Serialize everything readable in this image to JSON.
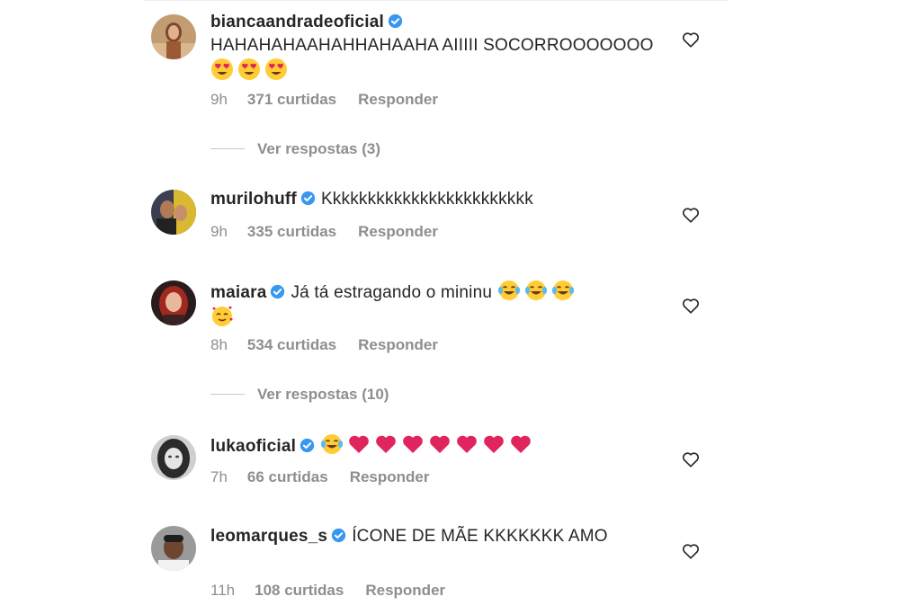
{
  "comments": [
    {
      "username": "biancaandradeoficial",
      "text": "HAHAHAHAAHAHHAHAAHA AIIIII SOCORROOOOOOO",
      "emojis": [
        "heart-eyes",
        "heart-eyes",
        "heart-eyes"
      ],
      "time": "9h",
      "likes": "371 curtidas",
      "reply_label": "Responder",
      "view_replies": "Ver respostas (3)"
    },
    {
      "username": "murilohuff",
      "text": "Kkkkkkkkkkkkkkkkkkkkkkkk",
      "emojis": [],
      "time": "9h",
      "likes": "335 curtidas",
      "reply_label": "Responder"
    },
    {
      "username": "maiara",
      "text": "Já tá estragando o mininu",
      "emojis": [
        "tears-of-joy",
        "tears-of-joy",
        "tears-of-joy",
        "smiling-hearts"
      ],
      "time": "8h",
      "likes": "534 curtidas",
      "reply_label": "Responder",
      "view_replies": "Ver respostas (10)"
    },
    {
      "username": "lukaoficial",
      "text": "",
      "emojis": [
        "tears-of-joy",
        "red-heart",
        "red-heart",
        "red-heart",
        "red-heart",
        "red-heart",
        "red-heart",
        "red-heart"
      ],
      "time": "7h",
      "likes": "66 curtidas",
      "reply_label": "Responder"
    },
    {
      "username": "leomarques_s",
      "text": "ÍCONE DE MÃE KKKKKKK AMO",
      "emojis": [],
      "time": "11h",
      "likes": "108 curtidas",
      "reply_label": "Responder"
    }
  ],
  "colors": {
    "text": "#262626",
    "muted": "#8e8e8e",
    "verified": "#3897f0",
    "heart_red": "#e0245e"
  }
}
